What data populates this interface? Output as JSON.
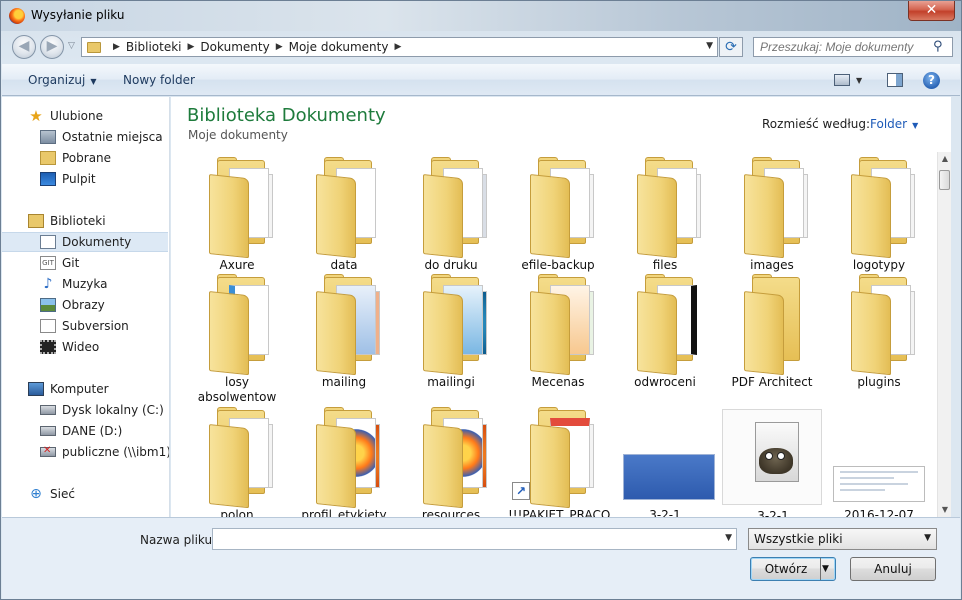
{
  "window": {
    "title": "Wysyłanie pliku",
    "close_label": "✕"
  },
  "address": {
    "crumbs": [
      "Biblioteki",
      "Dokumenty",
      "Moje dokumenty"
    ],
    "search_placeholder": "Przeszukaj: Moje dokumenty"
  },
  "toolbar": {
    "organize": "Organizuj",
    "new_folder": "Nowy folder",
    "help": "?"
  },
  "nav": {
    "favorites": "Ulubione",
    "recent": "Ostatnie miejsca",
    "downloads": "Pobrane",
    "desktop": "Pulpit",
    "libraries": "Biblioteki",
    "documents": "Dokumenty",
    "git": "Git",
    "music": "Muzyka",
    "pictures": "Obrazy",
    "subversion": "Subversion",
    "video": "Wideo",
    "computer": "Komputer",
    "disk_c": "Dysk lokalny (C:)",
    "disk_d": "DANE (D:)",
    "public": "publiczne (\\\\ibm1) (",
    "network": "Sieć"
  },
  "content": {
    "title": "Biblioteka Dokumenty",
    "subtitle": "Moje dokumenty",
    "arrange_label": "Rozmieść według:",
    "arrange_value": "Folder",
    "items": [
      "Axure",
      "data",
      "do druku",
      "efile-backup",
      "files",
      "images",
      "logotypy",
      "losy absolwentow",
      "mailing",
      "mailingi",
      "Mecenas",
      "odwroceni",
      "PDF Architect",
      "plugins",
      "polon",
      "profil_etykiety",
      "resources",
      "!!!PAKIET_PRACO",
      "3-2-1",
      "3-2-1",
      "2016-12-07"
    ]
  },
  "bottom": {
    "filename_label": "Nazwa pliku:",
    "filename_value": "",
    "filetype": "Wszystkie pliki",
    "open": "Otwórz",
    "cancel": "Anuluj"
  }
}
